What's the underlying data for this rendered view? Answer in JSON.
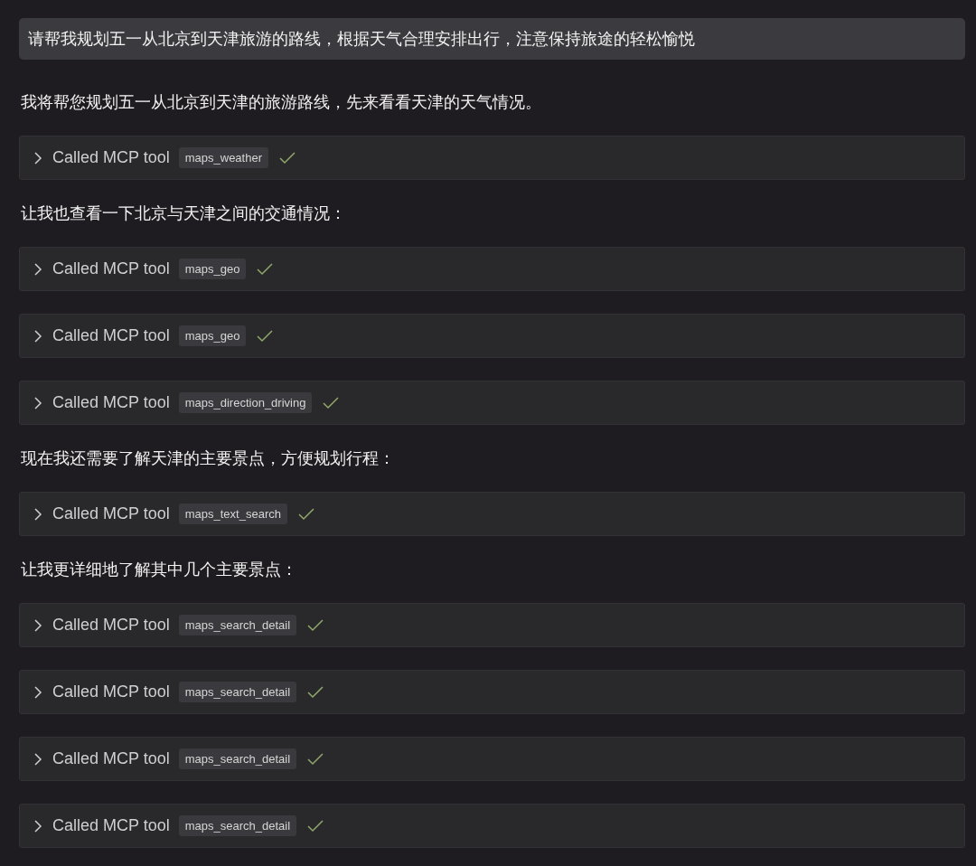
{
  "prompt": "请帮我规划五一从北京到天津旅游的路线，根据天气合理安排出行，注意保持旅途的轻松愉悦",
  "messages": [
    {
      "kind": "text",
      "text": "我将帮您规划五一从北京到天津的旅游路线，先来看看天津的天气情况。"
    },
    {
      "kind": "tool",
      "label": "Called MCP tool",
      "tool": "maps_weather",
      "expanded": false,
      "done": true
    },
    {
      "kind": "text",
      "text": "让我也查看一下北京与天津之间的交通情况："
    },
    {
      "kind": "tool",
      "label": "Called MCP tool",
      "tool": "maps_geo",
      "expanded": false,
      "done": true
    },
    {
      "kind": "tool",
      "label": "Called MCP tool",
      "tool": "maps_geo",
      "expanded": false,
      "done": true
    },
    {
      "kind": "tool",
      "label": "Called MCP tool",
      "tool": "maps_direction_driving",
      "expanded": false,
      "done": true
    },
    {
      "kind": "text",
      "text": "现在我还需要了解天津的主要景点，方便规划行程："
    },
    {
      "kind": "tool",
      "label": "Called MCP tool",
      "tool": "maps_text_search",
      "expanded": false,
      "done": true
    },
    {
      "kind": "text",
      "text": "让我更详细地了解其中几个主要景点："
    },
    {
      "kind": "tool",
      "label": "Called MCP tool",
      "tool": "maps_search_detail",
      "expanded": false,
      "done": true
    },
    {
      "kind": "tool",
      "label": "Called MCP tool",
      "tool": "maps_search_detail",
      "expanded": false,
      "done": true
    },
    {
      "kind": "tool",
      "label": "Called MCP tool",
      "tool": "maps_search_detail",
      "expanded": false,
      "done": true
    },
    {
      "kind": "tool",
      "label": "Called MCP tool",
      "tool": "maps_search_detail",
      "expanded": false,
      "done": true
    }
  ]
}
